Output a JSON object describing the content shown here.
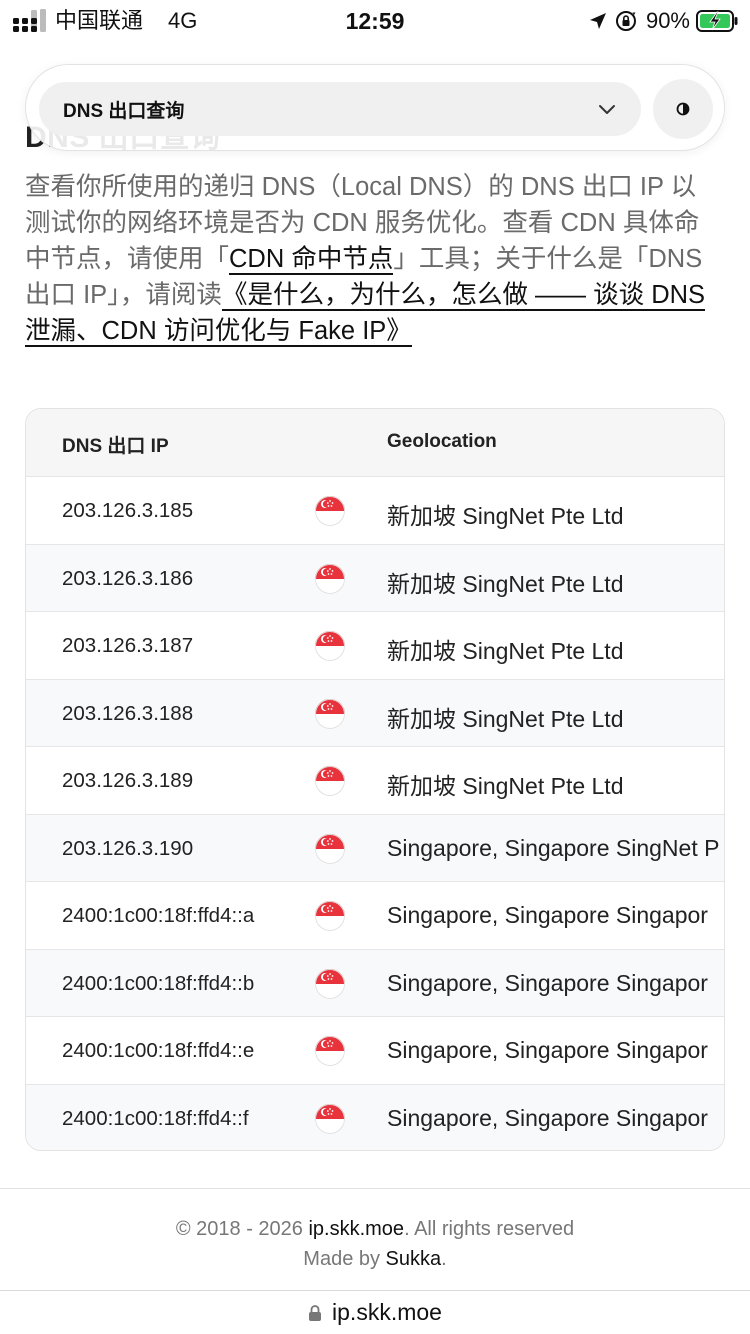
{
  "status_bar": {
    "carrier": "中国联通",
    "network": "4G",
    "time": "12:59",
    "battery_percent": "90%"
  },
  "selector": {
    "selected": "DNS 出口查询",
    "ghost_heading": "DNS 出口查询"
  },
  "description": {
    "p1": "查看你所使用的递归 DNS（Local DNS）的 DNS 出口 IP 以测试你的网络环境是否为 CDN 服务优化。查看 CDN 具体命中节点，请使用「",
    "link1": "CDN 命中节点",
    "p2": "」工具；关于什么是「DNS 出口 IP」，请阅读",
    "link2": "《是什么，为什么，怎么做 —— 谈谈 DNS 泄漏、CDN 访问优化与 Fake IP》"
  },
  "table": {
    "headers": [
      "DNS 出口 IP",
      "Geolocation"
    ],
    "rows": [
      {
        "ip": "203.126.3.185",
        "geo": "新加坡 SingNet Pte Ltd"
      },
      {
        "ip": "203.126.3.186",
        "geo": "新加坡 SingNet Pte Ltd"
      },
      {
        "ip": "203.126.3.187",
        "geo": "新加坡 SingNet Pte Ltd"
      },
      {
        "ip": "203.126.3.188",
        "geo": "新加坡 SingNet Pte Ltd"
      },
      {
        "ip": "203.126.3.189",
        "geo": "新加坡 SingNet Pte Ltd"
      },
      {
        "ip": "203.126.3.190",
        "geo": "Singapore, Singapore SingNet P"
      },
      {
        "ip": "2400:1c00:18f:ffd4::a",
        "geo": "Singapore, Singapore Singapor"
      },
      {
        "ip": "2400:1c00:18f:ffd4::b",
        "geo": "Singapore, Singapore Singapor"
      },
      {
        "ip": "2400:1c00:18f:ffd4::e",
        "geo": "Singapore, Singapore Singapor"
      },
      {
        "ip": "2400:1c00:18f:ffd4::f",
        "geo": "Singapore, Singapore Singapor"
      }
    ]
  },
  "footer": {
    "copyright": "© 2018 - 2026 ",
    "site": "ip.skk.moe",
    "rights": ". All rights reserved",
    "made_by": "Made by ",
    "author": "Sukka",
    "period": "."
  },
  "browser": {
    "url": "ip.skk.moe"
  },
  "colors": {
    "flag_red": "#e8323c",
    "flag_white": "#ffffff",
    "battery_green": "#34c759"
  },
  "icons": {
    "signal": "signal-dots-icon",
    "location": "location-arrow-icon",
    "rotation_lock": "rotation-lock-icon",
    "battery": "battery-charging-icon",
    "chevron": "chevron-down-icon",
    "theme": "theme-toggle-icon",
    "flag": "singapore-flag-icon",
    "lock": "lock-icon"
  }
}
